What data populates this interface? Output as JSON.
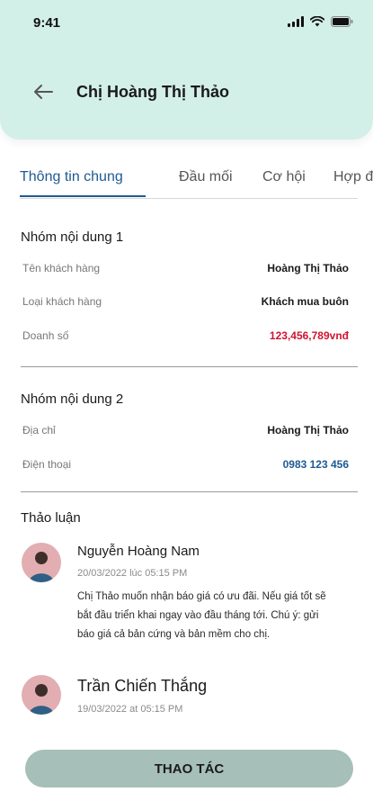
{
  "status_bar": {
    "time": "9:41"
  },
  "header": {
    "title": "Chị Hoàng Thị Thảo"
  },
  "tabs": [
    {
      "label": "Thông tin chung"
    },
    {
      "label": "Đầu mối"
    },
    {
      "label": "Cơ hội"
    },
    {
      "label": "Hợp đ"
    }
  ],
  "group1": {
    "title": "Nhóm nội dung 1",
    "rows": [
      {
        "label": "Tên khách hàng",
        "value": "Hoàng Thị Thảo"
      },
      {
        "label": "Loại khách hàng",
        "value": "Khách mua buôn"
      },
      {
        "label": "Doanh số",
        "value": "123,456,789vnđ"
      }
    ]
  },
  "group2": {
    "title": "Nhóm nội dung 2",
    "rows": [
      {
        "label": "Địa chỉ",
        "value": "Hoàng Thị Thảo"
      },
      {
        "label": "Điện thoại",
        "value": "0983 123 456"
      }
    ]
  },
  "discussion": {
    "title": "Thảo luận",
    "comments": [
      {
        "name": "Nguyễn Hoàng Nam",
        "time": "20/03/2022 lúc 05:15 PM",
        "text": "Chị Thảo muốn nhận báo giá có ưu đãi. Nếu giá tốt sẽ bắt đầu triển khai ngay vào đầu tháng tới. Chú ý: gửi báo giá cả bản cứng và bản mềm cho chị."
      },
      {
        "name": "Trần Chiến Thắng",
        "time": "19/03/2022 at 05:15 PM"
      }
    ]
  },
  "action": {
    "label": "THAO TÁC"
  },
  "colors": {
    "header_bg": "#d2efe8",
    "accent": "#1e5a92",
    "sales_red": "#d0142f",
    "button_bg": "#a6bfb9"
  }
}
